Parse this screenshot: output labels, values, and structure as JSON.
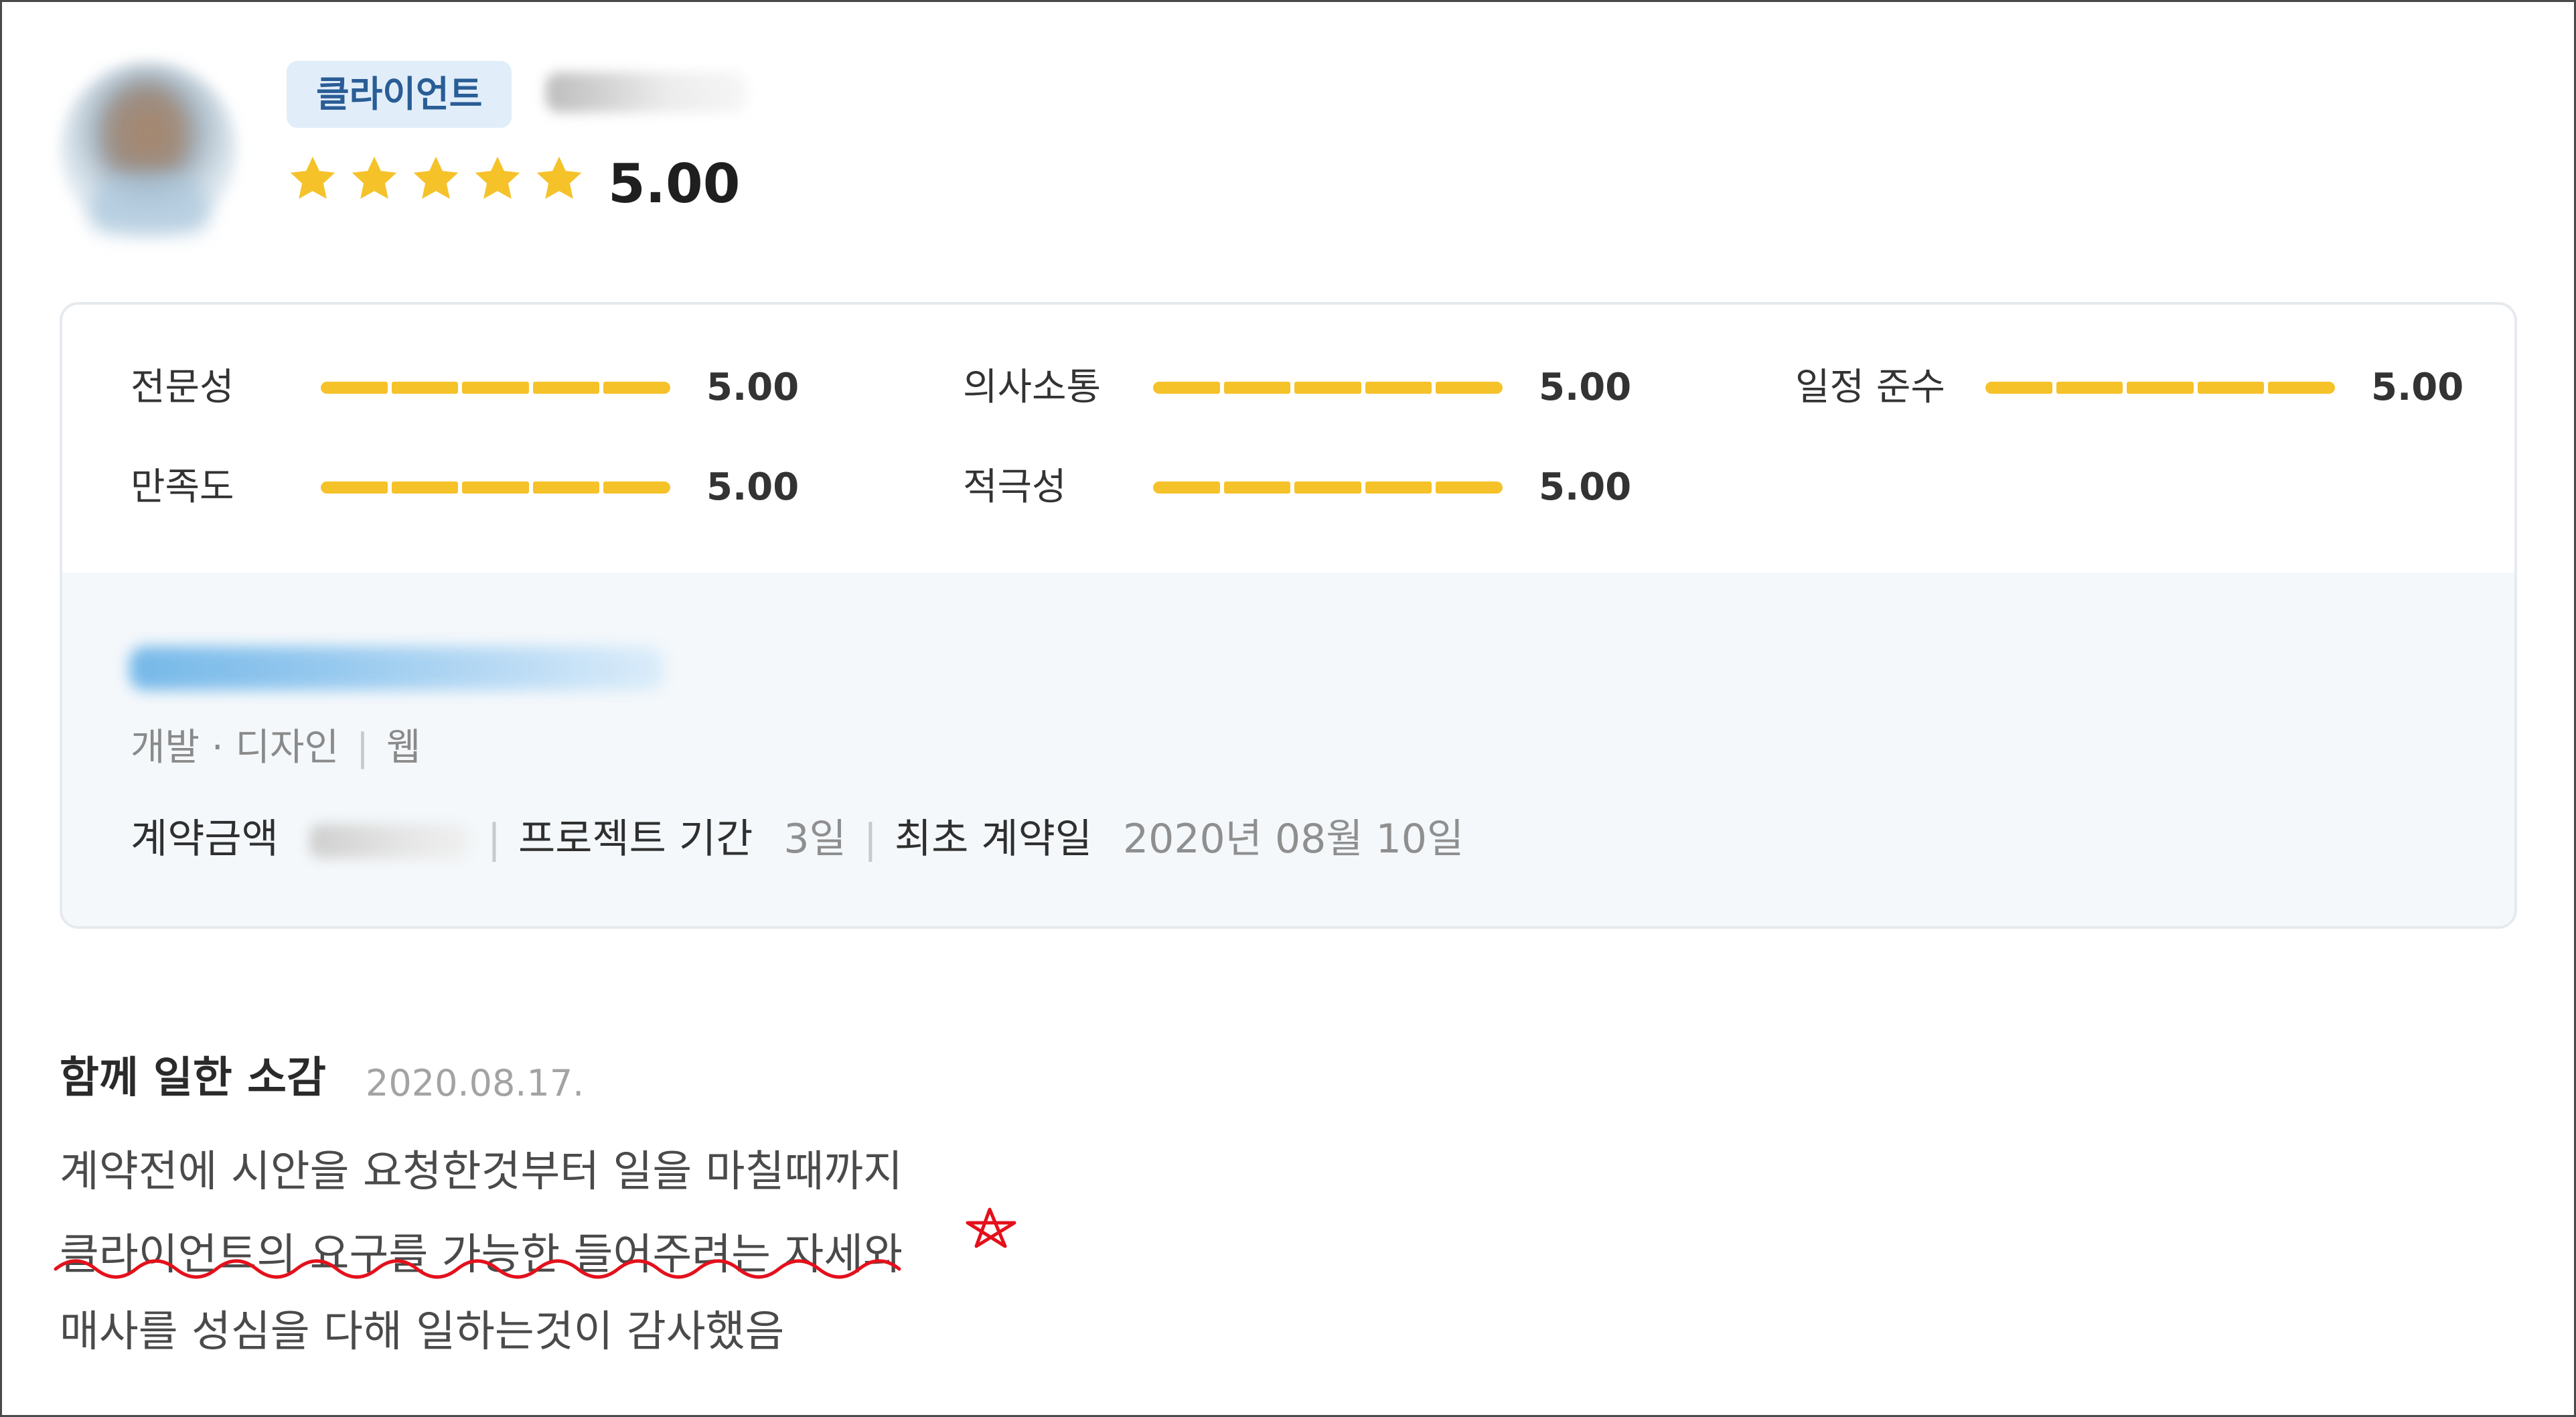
{
  "header": {
    "role_badge": "클라이언트",
    "rating_stars": 5,
    "overall_score": "5.00"
  },
  "ratings": {
    "items": [
      {
        "label": "전문성",
        "value": "5.00",
        "fill": 1.0
      },
      {
        "label": "의사소통",
        "value": "5.00",
        "fill": 1.0
      },
      {
        "label": "일정 준수",
        "value": "5.00",
        "fill": 1.0
      },
      {
        "label": "만족도",
        "value": "5.00",
        "fill": 1.0
      },
      {
        "label": "적극성",
        "value": "5.00",
        "fill": 1.0
      }
    ],
    "bar_color": "#f5c22a"
  },
  "project": {
    "category": "개발 · 디자인",
    "subcategory": "웹",
    "contract_amount_label": "계약금액",
    "duration_label": "프로젝트 기간",
    "duration_value": "3일",
    "first_contract_label": "최초 계약일",
    "first_contract_value": "2020년 08월 10일"
  },
  "review": {
    "heading": "함께 일한 소감",
    "date": "2020.08.17.",
    "lines": [
      "계약전에 시안을 요청한것부터 일을 마칠때까지",
      "클라이언트의 요구를 가능한 들어주려는 자세와",
      "매사를 성심을 다해 일하는것이 감사했음"
    ]
  },
  "colors": {
    "star": "#f5c22a",
    "badge_bg": "#e1eef9",
    "badge_text": "#2a5d96",
    "annotation": "#e4101b"
  }
}
